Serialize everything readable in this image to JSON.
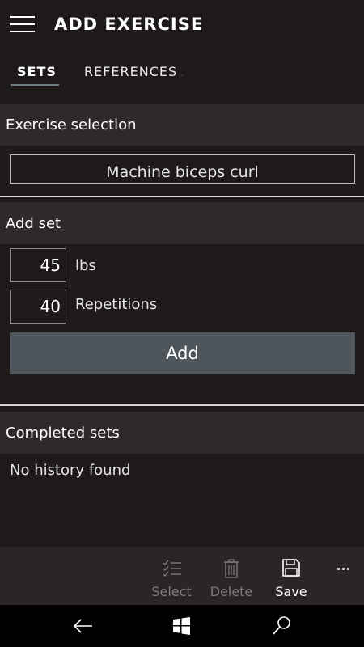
{
  "header": {
    "title": "ADD EXERCISE",
    "menu_icon": "hamburger-icon"
  },
  "pivot": {
    "tabs": [
      {
        "label": "SETS",
        "active": true
      },
      {
        "label": "REFERENCES AND NOTES",
        "active": false
      }
    ]
  },
  "exercise_selection": {
    "header": "Exercise selection",
    "selected": "Machine biceps curl"
  },
  "add_set": {
    "header": "Add set",
    "weight_value": "45",
    "weight_unit": "lbs",
    "reps_value": "40",
    "reps_unit": "Repetitions",
    "add_label": "Add"
  },
  "completed_sets": {
    "header": "Completed sets",
    "empty_message": "No history found"
  },
  "app_bar": {
    "buttons": [
      {
        "label": "Select",
        "icon": "multi-select-icon",
        "enabled": false
      },
      {
        "label": "Delete",
        "icon": "trash-icon",
        "enabled": false
      },
      {
        "label": "Save",
        "icon": "save-icon",
        "enabled": true
      }
    ],
    "more_icon": "ellipsis-icon"
  },
  "nav_bar": {
    "icons": [
      "back-arrow-icon",
      "windows-start-icon",
      "search-icon"
    ]
  },
  "colors": {
    "background": "#1f1a1a",
    "section_header": "#2f2929",
    "add_button": "#4e565c",
    "app_bar": "#2b2525"
  }
}
